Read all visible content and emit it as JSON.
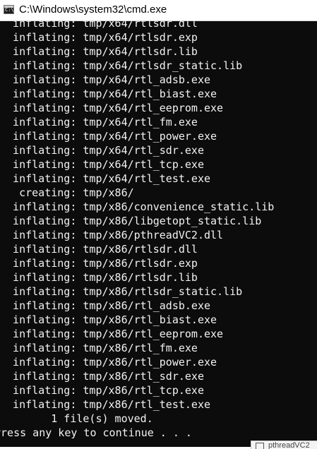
{
  "window": {
    "title": "C:\\Windows\\system32\\cmd.exe",
    "icon": "cmd-icon",
    "icon_glyph": "C:\\"
  },
  "console": {
    "lines": [
      "  inflating: tmp/x64/rtlsdr.dll",
      "  inflating: tmp/x64/rtlsdr.exp",
      "  inflating: tmp/x64/rtlsdr.lib",
      "  inflating: tmp/x64/rtlsdr_static.lib",
      "  inflating: tmp/x64/rtl_adsb.exe",
      "  inflating: tmp/x64/rtl_biast.exe",
      "  inflating: tmp/x64/rtl_eeprom.exe",
      "  inflating: tmp/x64/rtl_fm.exe",
      "  inflating: tmp/x64/rtl_power.exe",
      "  inflating: tmp/x64/rtl_sdr.exe",
      "  inflating: tmp/x64/rtl_tcp.exe",
      "  inflating: tmp/x64/rtl_test.exe",
      "   creating: tmp/x86/",
      "  inflating: tmp/x86/convenience_static.lib",
      "  inflating: tmp/x86/libgetopt_static.lib",
      "  inflating: tmp/x86/pthreadVC2.dll",
      "  inflating: tmp/x86/rtlsdr.dll",
      "  inflating: tmp/x86/rtlsdr.exp",
      "  inflating: tmp/x86/rtlsdr.lib",
      "  inflating: tmp/x86/rtlsdr_static.lib",
      "  inflating: tmp/x86/rtl_adsb.exe",
      "  inflating: tmp/x86/rtl_biast.exe",
      "  inflating: tmp/x86/rtl_eeprom.exe",
      "  inflating: tmp/x86/rtl_fm.exe",
      "  inflating: tmp/x86/rtl_power.exe",
      "  inflating: tmp/x86/rtl_sdr.exe",
      "  inflating: tmp/x86/rtl_tcp.exe",
      "  inflating: tmp/x86/rtl_test.exe",
      "        1 file(s) moved.",
      "Press any key to continue . . ."
    ]
  },
  "taskbar_peek": {
    "text": "pthreadVC2"
  },
  "colors": {
    "console_bg": "#0c0c0c",
    "console_fg": "#f2f2f2",
    "titlebar_bg": "#ffffff"
  }
}
